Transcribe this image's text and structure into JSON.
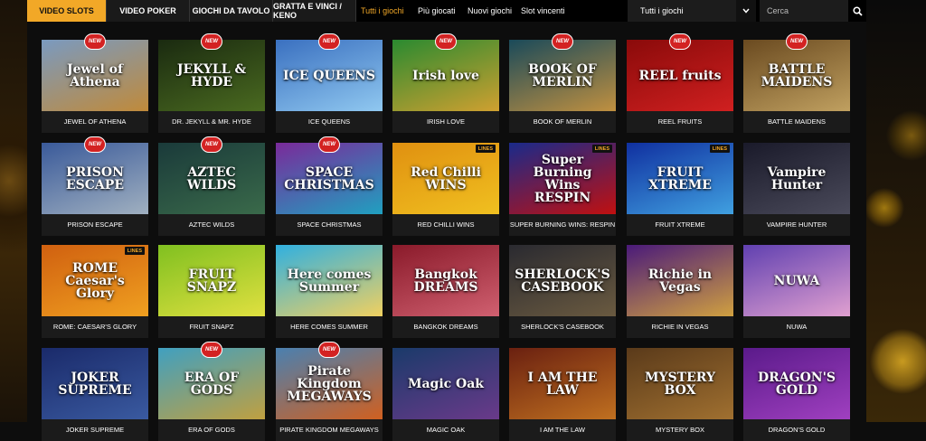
{
  "nav": {
    "tabs": [
      {
        "label": "VIDEO SLOTS",
        "active": true
      },
      {
        "label": "VIDEO POKER",
        "active": false
      },
      {
        "label": "GIOCHI DA TAVOLO",
        "active": false
      },
      {
        "label": "GRATTA E VINCI / KENO",
        "active": false
      }
    ],
    "filters": [
      {
        "label": "Tutti i giochi",
        "active": true
      },
      {
        "label": "Più giocati",
        "active": false
      },
      {
        "label": "Nuovi giochi",
        "active": false
      },
      {
        "label": "Slot vincenti",
        "active": false
      }
    ],
    "select_value": "Tutti i giochi",
    "search_placeholder": "Cerca"
  },
  "badges": {
    "new": "NEW",
    "lines": "LINES"
  },
  "colors": {
    "accent": "#f2a827",
    "new_badge": "#d32222"
  },
  "games": [
    {
      "name": "JEWEL OF ATHENA",
      "art": "Jewel of Athena",
      "new": true,
      "lines": false,
      "bg": [
        "#7a9ac0",
        "#c08a3a"
      ]
    },
    {
      "name": "DR. JEKYLL & MR. HYDE",
      "art": "JEKYLL & HYDE",
      "new": true,
      "lines": false,
      "bg": [
        "#1a2a10",
        "#4a6a20"
      ]
    },
    {
      "name": "ICE QUEENS",
      "art": "ICE QUEENS",
      "new": true,
      "lines": false,
      "bg": [
        "#3a70c0",
        "#90c8f0"
      ]
    },
    {
      "name": "IRISH LOVE",
      "art": "Irish love",
      "new": true,
      "lines": false,
      "bg": [
        "#2a8a30",
        "#d0a030"
      ]
    },
    {
      "name": "BOOK OF MERLIN",
      "art": "BOOK OF MERLIN",
      "new": true,
      "lines": false,
      "bg": [
        "#1a4a5a",
        "#c09040"
      ]
    },
    {
      "name": "REEL FRUITS",
      "art": "REEL fruits",
      "new": true,
      "lines": false,
      "bg": [
        "#8a0a0a",
        "#d02020"
      ]
    },
    {
      "name": "BATTLE MAIDENS",
      "art": "BATTLE MAIDENS",
      "new": true,
      "lines": false,
      "bg": [
        "#6a4a20",
        "#c0a060"
      ]
    },
    {
      "name": "PRISON ESCAPE",
      "art": "PRISON ESCAPE",
      "new": true,
      "lines": false,
      "bg": [
        "#3a5a9a",
        "#a0b0c0"
      ]
    },
    {
      "name": "AZTEC WILDS",
      "art": "AZTEC WILDS",
      "new": true,
      "lines": false,
      "bg": [
        "#1a3a3a",
        "#3a6a4a"
      ]
    },
    {
      "name": "SPACE CHRISTMAS",
      "art": "SPACE CHRISTMAS",
      "new": true,
      "lines": false,
      "bg": [
        "#7a2a9a",
        "#20a0c0"
      ]
    },
    {
      "name": "RED CHILLI WINS",
      "art": "Red Chilli WINS",
      "new": false,
      "lines": true,
      "bg": [
        "#e09010",
        "#f0c020"
      ]
    },
    {
      "name": "SUPER BURNING WINS: RESPIN",
      "art": "Super Burning Wins RESPIN",
      "new": false,
      "lines": true,
      "bg": [
        "#1a2a8a",
        "#c01010"
      ]
    },
    {
      "name": "FRUIT XTREME",
      "art": "FRUIT XTREME",
      "new": false,
      "lines": true,
      "bg": [
        "#1030a0",
        "#40a0e0"
      ]
    },
    {
      "name": "VAMPIRE HUNTER",
      "art": "Vampire Hunter",
      "new": false,
      "lines": false,
      "bg": [
        "#1a1a2a",
        "#4a4a5a"
      ]
    },
    {
      "name": "ROME: CAESAR'S GLORY",
      "art": "ROME Caesar's Glory",
      "new": false,
      "lines": true,
      "bg": [
        "#d06010",
        "#f0a020"
      ]
    },
    {
      "name": "FRUIT SNAPZ",
      "art": "FRUIT SNAPZ",
      "new": false,
      "lines": false,
      "bg": [
        "#80c020",
        "#e0e040"
      ]
    },
    {
      "name": "HERE COMES SUMMER",
      "art": "Here comes Summer",
      "new": false,
      "lines": false,
      "bg": [
        "#30b0e0",
        "#f0d060"
      ]
    },
    {
      "name": "BANGKOK DREAMS",
      "art": "Bangkok DREAMS",
      "new": false,
      "lines": false,
      "bg": [
        "#8a1a2a",
        "#d06070"
      ]
    },
    {
      "name": "SHERLOCK'S CASEBOOK",
      "art": "SHERLOCK'S CASEBOOK",
      "new": false,
      "lines": false,
      "bg": [
        "#2a2a30",
        "#6a5a40"
      ]
    },
    {
      "name": "RICHIE IN VEGAS",
      "art": "Richie in Vegas",
      "new": false,
      "lines": false,
      "bg": [
        "#4a1a7a",
        "#d0a040"
      ]
    },
    {
      "name": "NUWA",
      "art": "NUWA",
      "new": false,
      "lines": false,
      "bg": [
        "#6040b0",
        "#e0a0d0"
      ]
    },
    {
      "name": "JOKER SUPREME",
      "art": "JOKER SUPREME",
      "new": false,
      "lines": false,
      "bg": [
        "#1a2a6a",
        "#3a5aa0"
      ]
    },
    {
      "name": "ERA OF GODS",
      "art": "ERA OF GODS",
      "new": true,
      "lines": false,
      "bg": [
        "#40a0c0",
        "#c0a040"
      ]
    },
    {
      "name": "PIRATE KINGDOM MEGAWAYS",
      "art": "Pirate Kingdom MEGAWAYS",
      "new": true,
      "lines": false,
      "bg": [
        "#4a80b0",
        "#d06020"
      ]
    },
    {
      "name": "MAGIC OAK",
      "art": "Magic Oak",
      "new": false,
      "lines": false,
      "bg": [
        "#1a3a6a",
        "#6a3a8a"
      ]
    },
    {
      "name": "I AM THE LAW",
      "art": "I AM THE LAW",
      "new": false,
      "lines": false,
      "bg": [
        "#6a2010",
        "#c07020"
      ]
    },
    {
      "name": "MYSTERY BOX",
      "art": "MYSTERY BOX",
      "new": false,
      "lines": false,
      "bg": [
        "#5a3a1a",
        "#a07030"
      ]
    },
    {
      "name": "DRAGON'S GOLD",
      "art": "DRAGON'S GOLD",
      "new": false,
      "lines": false,
      "bg": [
        "#5a1a8a",
        "#a040c0"
      ]
    }
  ]
}
